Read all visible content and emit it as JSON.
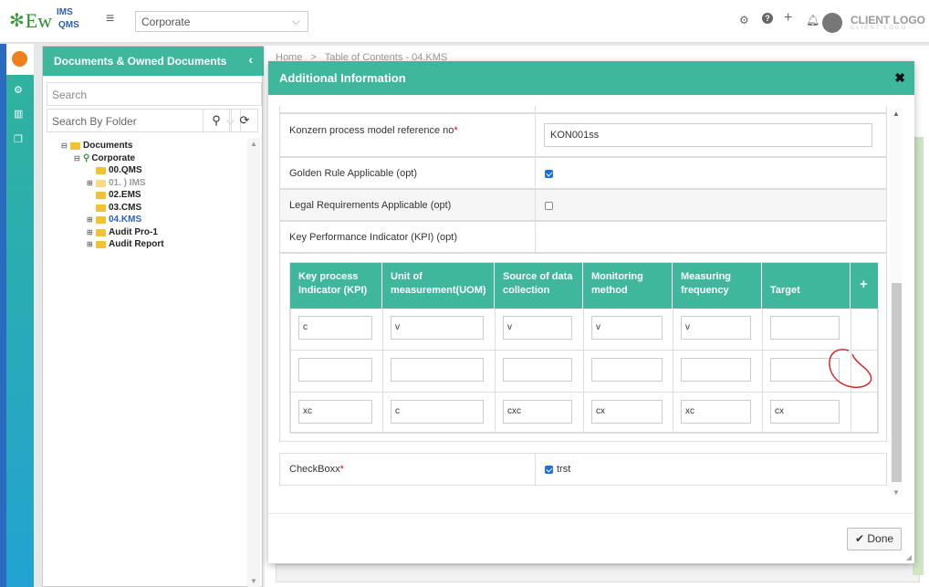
{
  "header": {
    "logo_main": "Ew",
    "logo_top": "IMS",
    "logo_bottom": "QMS",
    "org_select_value": "Corporate",
    "client_logo": "CLIENT LOGO",
    "client_logo_sub": "CLIENT LOGO"
  },
  "sidebar": {
    "title": "Documents & Owned Documents",
    "search_placeholder": "Search",
    "folder_select": "Search By Folder",
    "tree": [
      {
        "label": "Documents",
        "style": "normal"
      },
      {
        "label": "Corporate",
        "style": "normal"
      },
      {
        "label": "00.QMS",
        "style": "normal"
      },
      {
        "label": "01. ) IMS",
        "style": "grey"
      },
      {
        "label": "02.EMS",
        "style": "normal"
      },
      {
        "label": "03.CMS",
        "style": "normal"
      },
      {
        "label": "04.KMS",
        "style": "blue"
      },
      {
        "label": "Audit Pro-1",
        "style": "normal"
      },
      {
        "label": "Audit Report",
        "style": "normal"
      }
    ]
  },
  "breadcrumb": {
    "home": "Home",
    "sep": ">",
    "page": "Table of Contents - 04.KMS"
  },
  "modal": {
    "title": "Additional Information",
    "fields": {
      "konzern_label": "Konzern process model reference no",
      "konzern_value": "KON001ss",
      "golden_label": "Golden Rule Applicable (opt)",
      "golden_checked": true,
      "legal_label": "Legal Requirements Applicable (opt)",
      "legal_checked": false,
      "kpi_label": "Key Performance Indicator (KPI) (opt)",
      "checkbox_label": "CheckBoxx",
      "checkbox_option": "trst",
      "checkbox_checked": true
    },
    "kpi_table": {
      "headers": [
        "Key process Indicator (KPI)",
        "Unit of measurement(UOM)",
        "Source of data collection",
        "Monitoring method",
        "Measuring frequency",
        "Target"
      ],
      "add_label": "+",
      "rows": [
        [
          "c",
          "v",
          "v",
          "v",
          "v",
          ""
        ],
        [
          "",
          "",
          "",
          "",
          "",
          ""
        ],
        [
          "xc",
          "c",
          "cxc",
          "cx",
          "xc",
          "cx"
        ]
      ]
    },
    "done_label": "Done"
  },
  "colors": {
    "accent": "#3fb79d",
    "brand_blue": "#2a6bc0",
    "annotation": "#d9262c"
  }
}
